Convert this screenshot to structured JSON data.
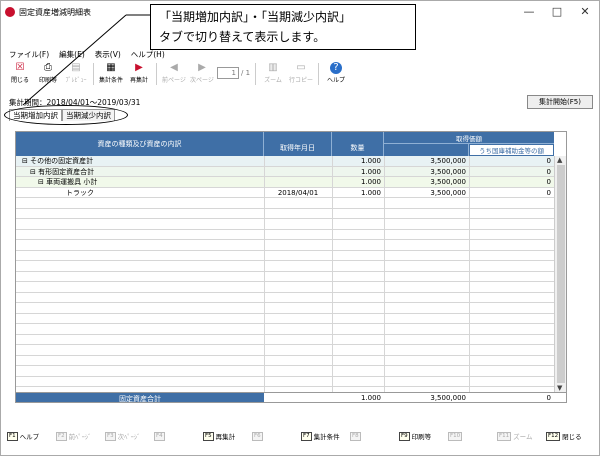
{
  "window": {
    "title": "固定資産増減明細表",
    "minimize": "—",
    "maximize": "□",
    "close": "✕"
  },
  "menu": [
    "ファイル(F)",
    "編集(E)",
    "表示(V)",
    "ヘルプ(H)"
  ],
  "toolbar": {
    "buttons": [
      {
        "label": "閉じる",
        "icon": "close-doc-icon",
        "enabled": true
      },
      {
        "label": "印刷等",
        "icon": "printer-icon",
        "enabled": true
      },
      {
        "label": "ﾌﾟﾚﾋﾞｭｰ",
        "icon": "preview-icon",
        "enabled": false
      },
      {
        "label": "集計条件",
        "icon": "conditions-icon",
        "enabled": true
      },
      {
        "label": "再集計",
        "icon": "recalc-icon",
        "enabled": true
      },
      {
        "label": "前ページ",
        "icon": "arrow-left-icon",
        "enabled": false
      },
      {
        "label": "次ページ",
        "icon": "arrow-right-icon",
        "enabled": false
      },
      {
        "label": "ズーム",
        "icon": "zoom-icon",
        "enabled": false
      },
      {
        "label": "行コピー",
        "icon": "copy-row-icon",
        "enabled": false
      },
      {
        "label": "ヘルプ",
        "icon": "help-icon",
        "enabled": true
      }
    ],
    "page_value": "1",
    "page_of": "/ 1"
  },
  "period": {
    "label": "集計期間：",
    "range": "2018/04/01～2019/03/31"
  },
  "calc_start_button": "集計開始(F5)",
  "tabs": [
    "当期増加内訳",
    "当期減少内訳"
  ],
  "active_tab": 0,
  "table": {
    "headers": {
      "kind": "資産の種類及び資産の内訳",
      "date": "取得年月日",
      "qty": "数量",
      "cost_group": "取得価額",
      "subsidy": "うち国庫補助金等の額"
    },
    "rows": [
      {
        "name": "⊟ その他の固定資産計",
        "date": "",
        "qty": "1.000",
        "cost": "3,500,000",
        "subsidy": "0",
        "shade": "#e8f2f4"
      },
      {
        "name": "⊟ 有形固定資産合計",
        "date": "",
        "qty": "1.000",
        "cost": "3,500,000",
        "subsidy": "0",
        "shade": "#eef6ee"
      },
      {
        "name": "⊟ 車両運搬具 小計",
        "date": "",
        "qty": "1.000",
        "cost": "3,500,000",
        "subsidy": "0",
        "shade": "#f1f9ea"
      },
      {
        "name": "トラック",
        "date": "2018/04/01",
        "qty": "1.000",
        "cost": "3,500,000",
        "subsidy": "0",
        "shade": "#ffffff"
      }
    ],
    "total": {
      "label": "固定資産合計",
      "qty": "1.000",
      "cost": "3,500,000",
      "subsidy": "0"
    }
  },
  "fkeys": [
    {
      "key": "F1",
      "label": "ヘルプ",
      "enabled": true
    },
    {
      "key": "F2",
      "label": "前ﾍﾟｰｼﾞ",
      "enabled": false
    },
    {
      "key": "F3",
      "label": "次ﾍﾟｰｼﾞ",
      "enabled": false
    },
    {
      "key": "F4",
      "label": "",
      "enabled": false
    },
    {
      "key": "F5",
      "label": "再集計",
      "enabled": true
    },
    {
      "key": "F6",
      "label": "",
      "enabled": false
    },
    {
      "key": "F7",
      "label": "集計条件",
      "enabled": true
    },
    {
      "key": "F8",
      "label": "",
      "enabled": false
    },
    {
      "key": "F9",
      "label": "印刷等",
      "enabled": true
    },
    {
      "key": "F10",
      "label": "",
      "enabled": false
    },
    {
      "key": "F11",
      "label": "ズーム",
      "enabled": false
    },
    {
      "key": "F12",
      "label": "閉じる",
      "enabled": true
    }
  ],
  "callout": {
    "line1": "「当期増加内訳」・「当期減少内訳」",
    "line2": "タブで切り替えて表示します。"
  },
  "colors": {
    "header_blue": "#3f6fa6",
    "brand_red": "#c8102e"
  }
}
